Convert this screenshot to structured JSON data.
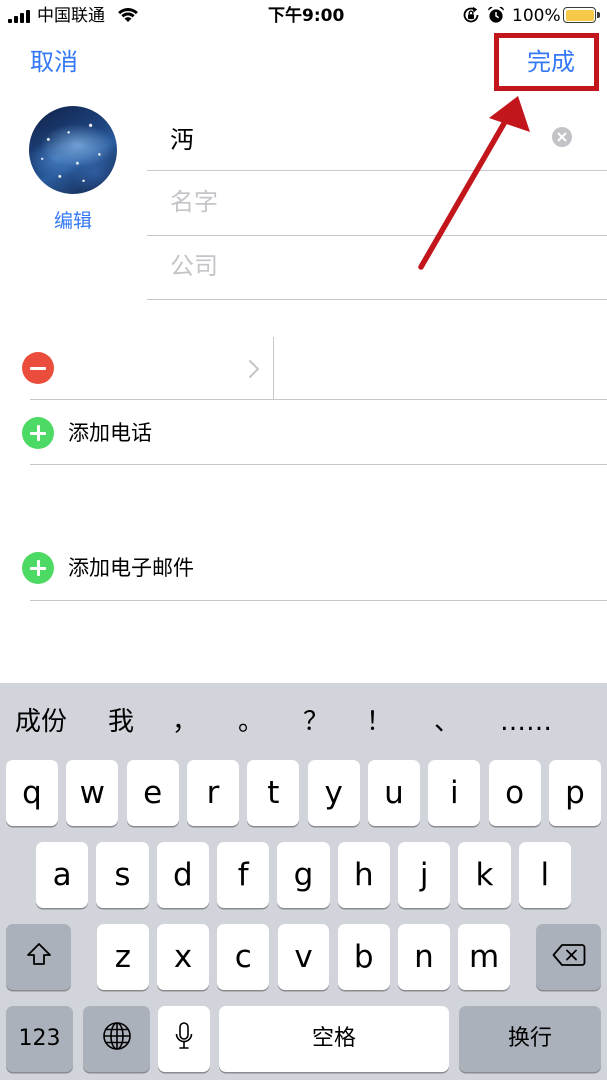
{
  "status_bar": {
    "carrier": "中国联通",
    "time": "下午9:00",
    "battery_percent": "100%",
    "icons": [
      "signal-icon",
      "wifi-icon",
      "rotation-lock-icon",
      "alarm-icon",
      "battery-icon"
    ]
  },
  "nav": {
    "cancel_label": "取消",
    "done_label": "完成"
  },
  "avatar": {
    "edit_label": "编辑"
  },
  "contact": {
    "last_name": "沔",
    "first_name_placeholder": "名字",
    "company_placeholder": "公司"
  },
  "phone": {
    "add_label": "添加电话",
    "icons": [
      "minus-circle-icon",
      "chevron-right-icon",
      "plus-circle-icon"
    ]
  },
  "email": {
    "add_label": "添加电子邮件"
  },
  "keyboard": {
    "suggestions": [
      "成份",
      "我",
      "，",
      "。",
      "？",
      "！",
      "、",
      "……"
    ],
    "row1": [
      "q",
      "w",
      "e",
      "r",
      "t",
      "y",
      "u",
      "i",
      "o",
      "p"
    ],
    "row2": [
      "a",
      "s",
      "d",
      "f",
      "g",
      "h",
      "j",
      "k",
      "l"
    ],
    "row3": [
      "z",
      "x",
      "c",
      "v",
      "b",
      "n",
      "m"
    ],
    "numbers_key": "123",
    "space_key": "空格",
    "return_key": "换行",
    "icons": [
      "shift-icon",
      "delete-icon",
      "globe-icon",
      "microphone-icon"
    ]
  },
  "colors": {
    "accent": "#3478f6",
    "delete_red": "#eb4d3d",
    "add_green": "#4cd964",
    "annotation_red": "#c3161c",
    "keyboard_bg": "#d1d4da",
    "function_key": "#abb1bb",
    "battery_fill": "#f7c948"
  }
}
